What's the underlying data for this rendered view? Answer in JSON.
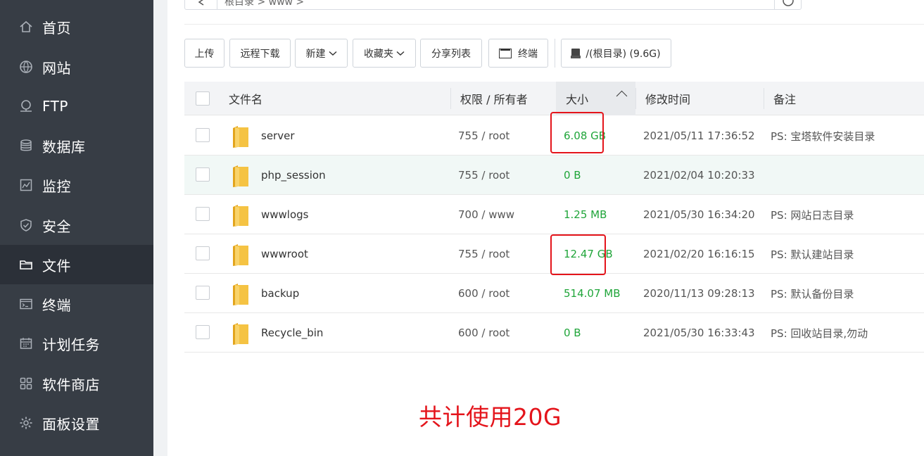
{
  "sidebar": {
    "items": [
      {
        "label": "首页",
        "icon": "home-icon"
      },
      {
        "label": "网站",
        "icon": "globe-icon"
      },
      {
        "label": "FTP",
        "icon": "ftp-icon"
      },
      {
        "label": "数据库",
        "icon": "database-icon"
      },
      {
        "label": "监控",
        "icon": "monitor-icon"
      },
      {
        "label": "安全",
        "icon": "shield-icon"
      },
      {
        "label": "文件",
        "icon": "folder-icon",
        "active": true
      },
      {
        "label": "终端",
        "icon": "terminal-icon"
      },
      {
        "label": "计划任务",
        "icon": "calendar-icon"
      },
      {
        "label": "软件商店",
        "icon": "grid-icon"
      },
      {
        "label": "面板设置",
        "icon": "gear-icon"
      }
    ]
  },
  "path": {
    "crumbs": "根目录  >  www  >"
  },
  "toolbar": {
    "upload": "上传",
    "remote_download": "远程下载",
    "new": "新建",
    "favorites": "收藏夹",
    "share_list": "分享列表",
    "terminal": "终端",
    "disk": "/(根目录) (9.6G)"
  },
  "table": {
    "headers": {
      "name": "文件名",
      "perm": "权限 / 所有者",
      "size": "大小",
      "mtime": "修改时间",
      "remark": "备注"
    },
    "rows": [
      {
        "name": "server",
        "perm": "755 / root",
        "size": "6.08 GB",
        "mtime": "2021/05/11 17:36:52",
        "remark": "PS: 宝塔软件安装目录"
      },
      {
        "name": "php_session",
        "perm": "755 / root",
        "size": "0 B",
        "mtime": "2021/02/04 10:20:33",
        "remark": ""
      },
      {
        "name": "wwwlogs",
        "perm": "700 / www",
        "size": "1.25 MB",
        "mtime": "2021/05/30 16:34:20",
        "remark": "PS: 网站日志目录"
      },
      {
        "name": "wwwroot",
        "perm": "755 / root",
        "size": "12.47 GB",
        "mtime": "2021/02/20 16:16:15",
        "remark": "PS: 默认建站目录"
      },
      {
        "name": "backup",
        "perm": "600 / root",
        "size": "514.07 MB",
        "mtime": "2020/11/13 09:28:13",
        "remark": "PS: 默认备份目录"
      },
      {
        "name": "Recycle_bin",
        "perm": "600 / root",
        "size": "0 B",
        "mtime": "2021/05/30 16:33:43",
        "remark": "PS: 回收站目录,勿动"
      }
    ]
  },
  "annotation": {
    "total": "共计使用20G"
  },
  "colors": {
    "sidebar": "#373d45",
    "size_text": "#20a53a",
    "annotation": "#e4141b",
    "folder": "#f5c343"
  }
}
